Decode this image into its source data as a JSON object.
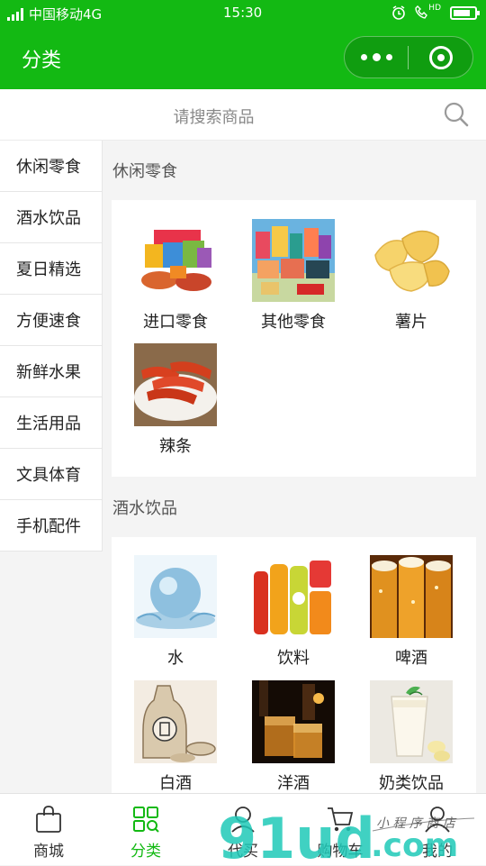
{
  "status_bar": {
    "carrier": "中国移动4G",
    "time": "15:30",
    "hd": "HD"
  },
  "header": {
    "title": "分类"
  },
  "search": {
    "placeholder": "请搜索商品"
  },
  "sidebar": {
    "items": [
      {
        "label": "休闲零食"
      },
      {
        "label": "酒水饮品"
      },
      {
        "label": "夏日精选"
      },
      {
        "label": "方便速食"
      },
      {
        "label": "新鲜水果"
      },
      {
        "label": "生活用品"
      },
      {
        "label": "文具体育"
      },
      {
        "label": "手机配件"
      }
    ]
  },
  "sections": [
    {
      "title": "休闲零食",
      "products": [
        {
          "name": "进口零食",
          "icon": "imported-snacks-image"
        },
        {
          "name": "其他零食",
          "icon": "other-snacks-image"
        },
        {
          "name": "薯片",
          "icon": "chips-image"
        },
        {
          "name": "辣条",
          "icon": "spicy-strips-image"
        }
      ]
    },
    {
      "title": "酒水饮品",
      "products": [
        {
          "name": "水",
          "icon": "water-image"
        },
        {
          "name": "饮料",
          "icon": "drinks-image"
        },
        {
          "name": "啤酒",
          "icon": "beer-image"
        },
        {
          "name": "白酒",
          "icon": "baijiu-image"
        },
        {
          "name": "洋酒",
          "icon": "spirits-image"
        },
        {
          "name": "奶类饮品",
          "icon": "milk-drinks-image"
        }
      ]
    }
  ],
  "tabbar": {
    "items": [
      {
        "label": "商城",
        "icon": "bag-icon"
      },
      {
        "label": "分类",
        "icon": "category-grid-icon",
        "active": true
      },
      {
        "label": "代买",
        "icon": "helper-icon"
      },
      {
        "label": "购物车",
        "icon": "cart-icon"
      },
      {
        "label": "我的",
        "icon": "user-icon"
      }
    ]
  },
  "watermark": {
    "logo": "91ud.com",
    "tagline": "小程序商店"
  },
  "colors": {
    "brand_green": "#13b913",
    "background": "#f4f4f4",
    "text": "#222222"
  }
}
